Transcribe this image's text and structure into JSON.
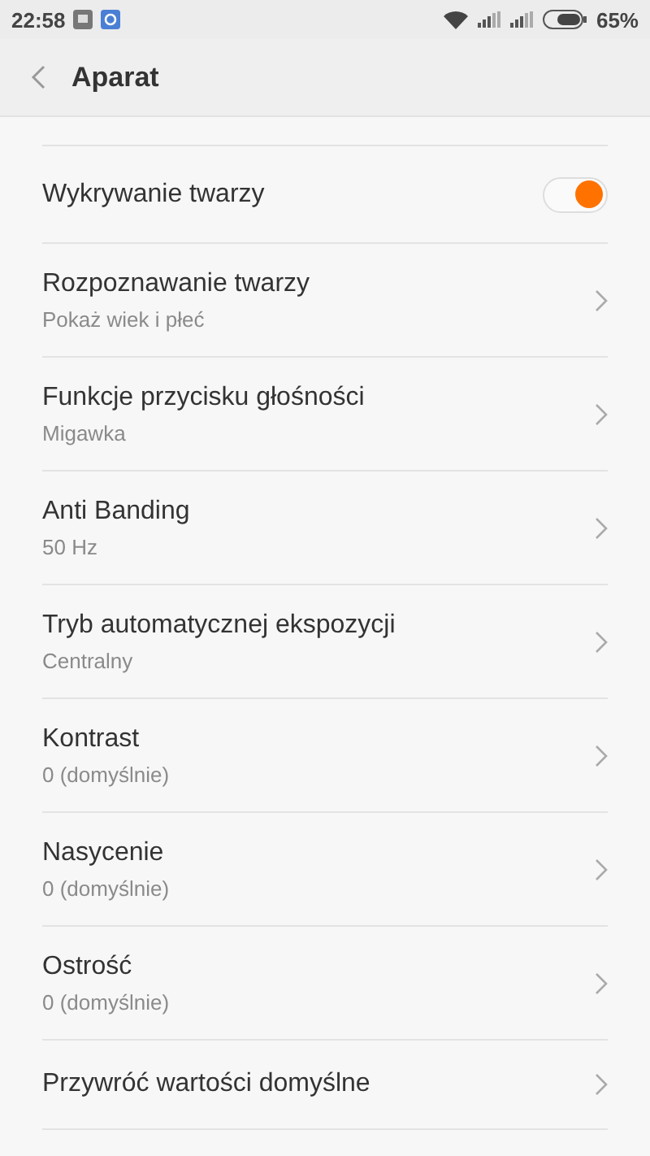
{
  "status_bar": {
    "time": "22:58",
    "battery": "65%"
  },
  "app_bar": {
    "title": "Aparat"
  },
  "items": [
    {
      "kind": "toggle",
      "title": "Wykrywanie twarzy",
      "on": true
    },
    {
      "kind": "nav",
      "title": "Rozpoznawanie twarzy",
      "subtitle": "Pokaż wiek i płeć"
    },
    {
      "kind": "nav",
      "title": "Funkcje przycisku głośności",
      "subtitle": "Migawka"
    },
    {
      "kind": "nav",
      "title": "Anti Banding",
      "subtitle": "50 Hz"
    },
    {
      "kind": "nav",
      "title": "Tryb automatycznej ekspozycji",
      "subtitle": "Centralny"
    },
    {
      "kind": "nav",
      "title": "Kontrast",
      "subtitle": "0 (domyślnie)"
    },
    {
      "kind": "nav",
      "title": "Nasycenie",
      "subtitle": "0 (domyślnie)"
    },
    {
      "kind": "nav",
      "title": "Ostrość",
      "subtitle": "0 (domyślnie)"
    },
    {
      "kind": "nav",
      "title": "Przywróć wartości domyślne"
    }
  ]
}
